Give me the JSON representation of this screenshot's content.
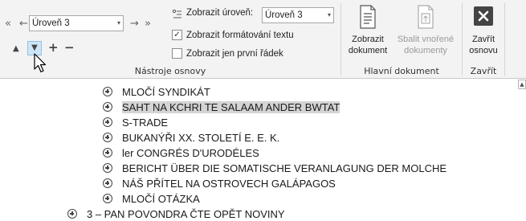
{
  "ribbon": {
    "nav": {
      "promote_top": "«",
      "promote": "←",
      "demote": "→",
      "demote_bottom": "»",
      "move_up": "▲",
      "move_down": "▼",
      "expand": "+",
      "collapse": "−"
    },
    "level_combo": {
      "value": "Úroveň 3",
      "caret": "▾"
    },
    "show_level": {
      "label": "Zobrazit úroveň:",
      "value": "Úroveň 3",
      "caret": "▾"
    },
    "show_formatting": {
      "label": "Zobrazit formátování textu",
      "checked": "✓"
    },
    "first_line_only": {
      "label": "Zobrazit jen první řádek"
    },
    "groups": {
      "outline_tools": "Nástroje osnovy",
      "master_document": "Hlavní dokument",
      "close": "Zavřít"
    },
    "buttons": {
      "show_document": [
        "Zobrazit",
        "dokument"
      ],
      "collapse_subdocs": [
        "Sbalit vnořené",
        "dokumenty"
      ],
      "close_outline": [
        "Zavřít",
        "osnovu"
      ]
    }
  },
  "outline": {
    "items": [
      "MLOČÍ SYNDIKÁT",
      "SAHT NA KCHRI TE SALAAM ANDER BWTAT",
      "S-TRADE",
      "BUKANÝŘI XX. STOLETÍ E. E. K.",
      "ler CONGRÉS D'URODÉLES",
      "BERICHT ÜBER DIE SOMATISCHE VERANLAGUNG DER MOLCHE",
      "NÁŠ PŘÍTEL NA OSTROVECH GALÁPAGOS",
      "MLOČÍ OTÁZKA"
    ],
    "chapter": "3 – PAN POVONDRA ČTE OPĚT NOVINY"
  }
}
